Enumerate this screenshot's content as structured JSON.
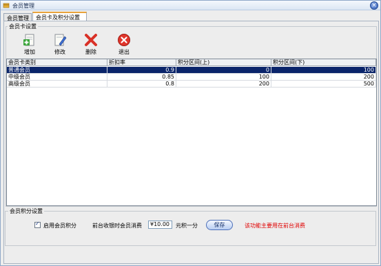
{
  "window": {
    "title": "会员管理",
    "close_icon": "close-icon"
  },
  "tabs": [
    {
      "label": "会员管理"
    },
    {
      "label": "会员卡及积分设置"
    }
  ],
  "card_group": {
    "title": "会员卡设置"
  },
  "toolbar": {
    "add_label": "增加",
    "edit_label": "修改",
    "delete_label": "删除",
    "exit_label": "退出"
  },
  "grid": {
    "columns": [
      "会员卡类别",
      "折扣率",
      "积分区间(上)",
      "积分区间(下)"
    ],
    "rows": [
      {
        "category": "普通会员",
        "discount": "0.9",
        "upper": "0",
        "lower": "100"
      },
      {
        "category": "中级会员",
        "discount": "0.85",
        "upper": "100",
        "lower": "200"
      },
      {
        "category": "高级会员",
        "discount": "0.8",
        "upper": "200",
        "lower": "500"
      }
    ],
    "selected_row": 0
  },
  "points_group": {
    "title": "会员积分设置",
    "enable_label": "启用会员积分",
    "enable_checked": true,
    "consume_label": "前台收银时会员消费",
    "amount_value": "¥10.00",
    "per_point_label": "元积一分",
    "save_label": "保存",
    "note": "该功能主要用在前台消费"
  },
  "colors": {
    "selected_row": "#0a246a",
    "note": "#e00000",
    "tab_accent": "#e8a33a"
  }
}
